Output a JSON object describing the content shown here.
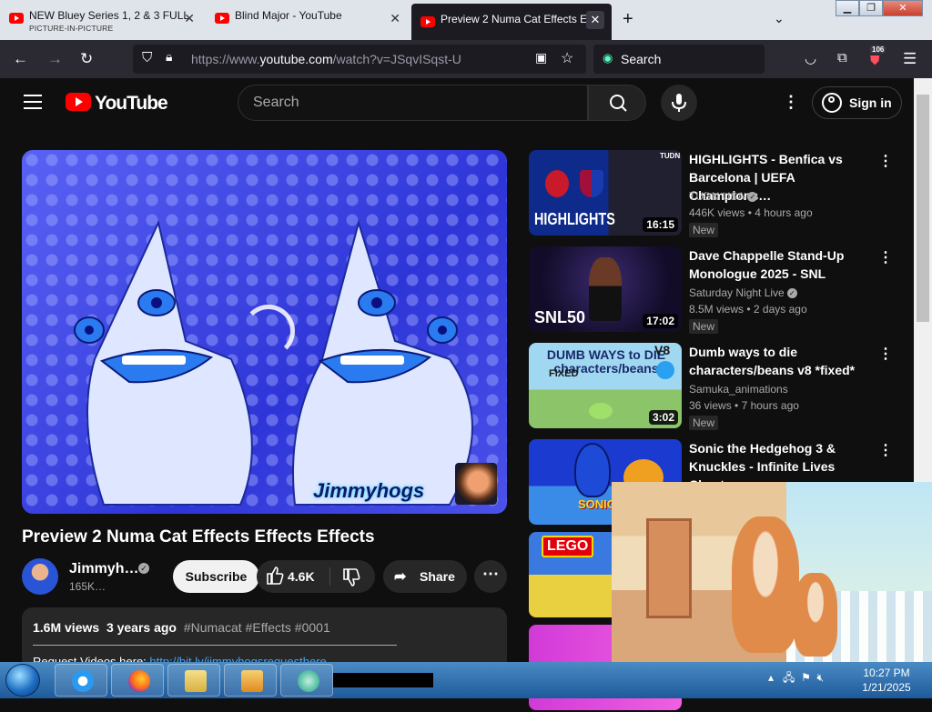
{
  "tabs": [
    {
      "title": "NEW Bluey Series 1, 2 & 3 FULL",
      "subtitle": "PICTURE-IN-PICTURE",
      "active": false
    },
    {
      "title": "Blind Major - YouTube",
      "active": false
    },
    {
      "title": "Preview 2 Numa Cat Effects Ef",
      "active": true
    }
  ],
  "browser": {
    "url_prefix": "https://www.",
    "url_domain": "youtube.com",
    "url_path": "/watch?v=JSqvISqst-U",
    "search_label": "Search",
    "extension_badge": "106"
  },
  "youtube": {
    "wordmark": "YouTube",
    "search_placeholder": "Search",
    "sign_in": "Sign in"
  },
  "video": {
    "watermark": "Jimmyhogs",
    "title": "Preview 2 Numa Cat Effects Effects Effects",
    "channel_name": "Jimmyh…",
    "subscribers": "165K…",
    "subscribe_label": "Subscribe",
    "likes": "4.6K",
    "share_label": "Share",
    "views": "1.6M views",
    "age": "3 years ago",
    "tags": "#Numacat #Effects #0001",
    "request_text": "Request Videos here: ",
    "request_link": "http://bit.ly/jimmyhogsrequesthere"
  },
  "recommendations": [
    {
      "title": "HIGHLIGHTS - Benfica vs Barcelona | UEFA Champions…",
      "channel": "TUDN USA",
      "verified": true,
      "views": "446K views",
      "age": "4 hours ago",
      "badge": "New",
      "duration": "16:15",
      "thumb_text": "HIGHLIGHTS",
      "thumb_tag": "TUDN"
    },
    {
      "title": "Dave Chappelle Stand-Up Monologue 2025 - SNL",
      "channel": "Saturday Night Live",
      "verified": true,
      "views": "8.5M views",
      "age": "2 days ago",
      "badge": "New",
      "duration": "17:02",
      "thumb_text": "SNL50"
    },
    {
      "title": "Dumb ways to die characters/beans v8 *fixed*",
      "channel": "Samuka_animations",
      "verified": false,
      "views": "36 views",
      "age": "7 hours ago",
      "badge": "New",
      "duration": "3:02",
      "thumb_text": "DUMB WAYS to DIE characters/beans",
      "thumb_tag": "V8",
      "thumb_fixed": "FIXED"
    },
    {
      "title": "Sonic the Hedgehog 3 & Knuckles - Infinite Lives Cheat",
      "thumb_text": "SONIC"
    },
    {
      "title": "",
      "thumb_text": "LEGO"
    },
    {
      "title": ""
    }
  ],
  "taskbar": {
    "time": "10:27 PM",
    "date": "1/21/2025"
  },
  "colors": {
    "youtube_red": "#ff0000",
    "page_bg": "#0f0f0f",
    "link_blue": "#3ea6ff",
    "player_blue": "#3a42e6"
  }
}
